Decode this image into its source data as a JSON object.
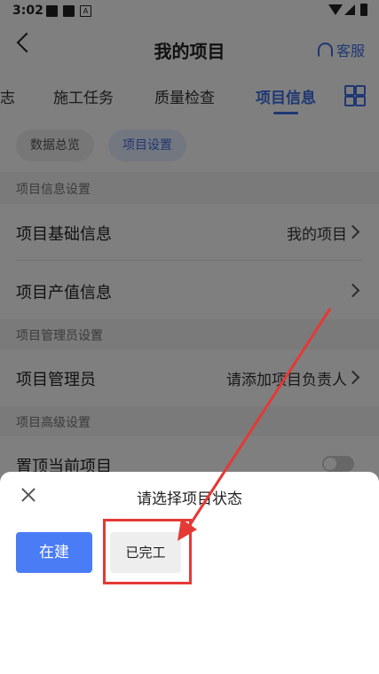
{
  "status_bar": {
    "time": "3:02",
    "icon_a": "A"
  },
  "header": {
    "title": "我的项目",
    "service_label": "客服"
  },
  "tabs": [
    {
      "label": "志"
    },
    {
      "label": "施工任务"
    },
    {
      "label": "质量检查"
    },
    {
      "label": "项目信息",
      "active": true
    }
  ],
  "chips": [
    {
      "label": "数据总览"
    },
    {
      "label": "项目设置",
      "selected": true
    }
  ],
  "sections": {
    "info": {
      "label": "项目信息设置",
      "rows": [
        {
          "label": "项目基础信息",
          "value": "我的项目"
        },
        {
          "label": "项目产值信息",
          "value": ""
        }
      ]
    },
    "admin": {
      "label": "项目管理员设置",
      "rows": [
        {
          "label": "项目管理员",
          "value": "请添加项目负责人"
        }
      ]
    },
    "advanced": {
      "label": "项目高级设置",
      "rows": [
        {
          "label": "置顶当前项目",
          "toggle": false
        }
      ]
    }
  },
  "sheet": {
    "title": "请选择项目状态",
    "options": [
      {
        "label": "在建"
      },
      {
        "label": "已完工"
      }
    ]
  },
  "colors": {
    "accent": "#3f6fe6",
    "primary_button": "#4a7cf5",
    "annotation": "#e53935"
  },
  "icons": [
    "back-chevron-icon",
    "headset-icon",
    "grid-menu-icon",
    "chevron-right-icon",
    "close-icon"
  ]
}
